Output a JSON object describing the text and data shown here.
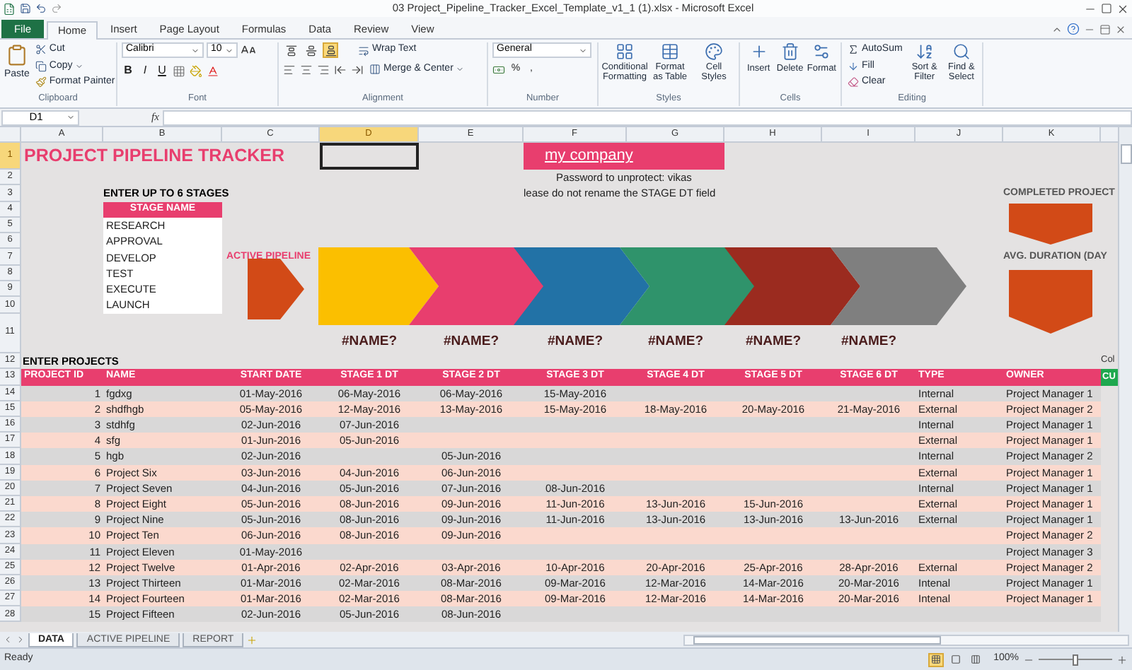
{
  "window": {
    "title": "03 Project_Pipeline_Tracker_Excel_Template_v1_1 (1).xlsx  -  Microsoft Excel"
  },
  "ribbon": {
    "file_tab": "File",
    "tabs": [
      {
        "label": "Home",
        "selected": true
      },
      {
        "label": "Insert",
        "selected": false
      },
      {
        "label": "Page Layout",
        "selected": false
      },
      {
        "label": "Formulas",
        "selected": false
      },
      {
        "label": "Data",
        "selected": false
      },
      {
        "label": "Review",
        "selected": false
      },
      {
        "label": "View",
        "selected": false
      }
    ],
    "clipboard": {
      "paste": "Paste",
      "cut": "Cut",
      "copy": "Copy",
      "format_painter": "Format Painter",
      "label": "Clipboard"
    },
    "font": {
      "name": "Calibri",
      "size": "10",
      "styles": [
        "B",
        "I",
        "U"
      ],
      "label": "Font"
    },
    "alignment": {
      "vertical_buttons": [
        {
          "selected": false
        },
        {
          "selected": false
        },
        {
          "selected": true
        }
      ],
      "wrap_text": "Wrap Text",
      "merge_center": "Merge & Center",
      "label": "Alignment"
    },
    "number": {
      "format": "General",
      "symbols": [
        "%",
        ","
      ],
      "label": "Number"
    },
    "styles": {
      "buttons": [
        "Conditional Formatting",
        "Format as Table",
        "Cell Styles"
      ],
      "label": "Styles"
    },
    "cells": {
      "buttons": [
        "Insert",
        "Delete",
        "Format"
      ],
      "label": "Cells"
    },
    "editing": {
      "autosum": "AutoSum",
      "fill": "Fill",
      "clear": "Clear",
      "buttons": [
        "Sort & Filter",
        "Find & Select"
      ],
      "label": "Editing"
    }
  },
  "formula_bar": {
    "name_box": "D1",
    "fx": "fx"
  },
  "columns": [
    {
      "label": "A",
      "selected": false
    },
    {
      "label": "B",
      "selected": false
    },
    {
      "label": "C",
      "selected": false
    },
    {
      "label": "D",
      "selected": true
    },
    {
      "label": "E",
      "selected": false
    },
    {
      "label": "F",
      "selected": false
    },
    {
      "label": "G",
      "selected": false
    },
    {
      "label": "H",
      "selected": false
    },
    {
      "label": "I",
      "selected": false
    },
    {
      "label": "J",
      "selected": false
    },
    {
      "label": "K",
      "selected": false
    }
  ],
  "row_numbers": [
    {
      "label": "1",
      "selected": true
    },
    {
      "label": "2",
      "selected": false
    },
    {
      "label": "3",
      "selected": false
    },
    {
      "label": "4",
      "selected": false
    },
    {
      "label": "5",
      "selected": false
    },
    {
      "label": "6",
      "selected": false
    },
    {
      "label": "7",
      "selected": false
    },
    {
      "label": "8",
      "selected": false
    },
    {
      "label": "9",
      "selected": false
    },
    {
      "label": "10",
      "selected": false
    },
    {
      "label": "11",
      "selected": false
    },
    {
      "label": "12",
      "selected": false
    },
    {
      "label": "13",
      "selected": false
    },
    {
      "label": "14",
      "selected": false
    },
    {
      "label": "15",
      "selected": false
    },
    {
      "label": "16",
      "selected": false
    },
    {
      "label": "17",
      "selected": false
    },
    {
      "label": "18",
      "selected": false
    },
    {
      "label": "19",
      "selected": false
    },
    {
      "label": "20",
      "selected": false
    },
    {
      "label": "21",
      "selected": false
    },
    {
      "label": "22",
      "selected": false
    },
    {
      "label": "23",
      "selected": false
    },
    {
      "label": "24",
      "selected": false
    },
    {
      "label": "25",
      "selected": false
    },
    {
      "label": "26",
      "selected": false
    },
    {
      "label": "27",
      "selected": false
    },
    {
      "label": "28",
      "selected": false
    }
  ],
  "sheet": {
    "title": "PROJECT PIPELINE TRACKER",
    "company_link": "my company",
    "password_note": "Password to unprotect: vikas",
    "rename_note": "lease do not rename the STAGE DT field",
    "stages_box": {
      "heading": "ENTER UP TO 6 STAGES",
      "header": "STAGE NAME",
      "items": [
        "RESEARCH",
        "APPROVAL",
        "DEVELOP",
        "TEST",
        "EXECUTE",
        "LAUNCH"
      ]
    },
    "pipeline": {
      "label": "ACTIVE PIPELINE",
      "stages": [
        {
          "label": "#NAME?",
          "color": "#fbbf00"
        },
        {
          "label": "#NAME?",
          "color": "#e83e6e"
        },
        {
          "label": "#NAME?",
          "color": "#2272a6"
        },
        {
          "label": "#NAME?",
          "color": "#2f936b"
        },
        {
          "label": "#NAME?",
          "color": "#9b2b1f"
        },
        {
          "label": "#NAME?",
          "color": "#7f7f7f"
        }
      ]
    },
    "completed_label": "COMPLETED PROJECT",
    "duration_label": "AVG. DURATION (DAY",
    "projects_heading": "ENTER PROJECTS",
    "column_l_note": "Col",
    "table": {
      "columns": [
        "PROJECT ID",
        "NAME",
        "START DATE",
        "STAGE 1 DT",
        "STAGE 2 DT",
        "STAGE 3 DT",
        "STAGE 4 DT",
        "STAGE 5 DT",
        "STAGE 6 DT",
        "TYPE",
        "OWNER"
      ],
      "column_l_heading": "CU",
      "rows": [
        {
          "id": "1",
          "name": "fgdxg",
          "start": "01-May-2016",
          "stages": {
            "1": "06-May-2016",
            "2": "06-May-2016",
            "3": "15-May-2016"
          },
          "type": "Internal",
          "owner": "Project Manager 1"
        },
        {
          "id": "2",
          "name": "shdfhgb",
          "start": "05-May-2016",
          "stages": {
            "1": "12-May-2016",
            "2": "13-May-2016",
            "3": "15-May-2016",
            "4": "18-May-2016",
            "5": "20-May-2016",
            "6": "21-May-2016"
          },
          "type": "External",
          "owner": "Project Manager 2"
        },
        {
          "id": "3",
          "name": "stdhfg",
          "start": "02-Jun-2016",
          "stages": {
            "1": "07-Jun-2016"
          },
          "type": "Internal",
          "owner": "Project Manager 1"
        },
        {
          "id": "4",
          "name": "sfg",
          "start": "01-Jun-2016",
          "stages": {
            "1": "05-Jun-2016"
          },
          "type": "External",
          "owner": "Project Manager 1"
        },
        {
          "id": "5",
          "name": "hgb",
          "start": "02-Jun-2016",
          "stages": {
            "2": "05-Jun-2016"
          },
          "type": "Internal",
          "owner": "Project Manager 2"
        },
        {
          "id": "6",
          "name": "Project Six",
          "start": "03-Jun-2016",
          "stages": {
            "1": "04-Jun-2016",
            "2": "06-Jun-2016"
          },
          "type": "External",
          "owner": "Project Manager 1"
        },
        {
          "id": "7",
          "name": "Project Seven",
          "start": "04-Jun-2016",
          "stages": {
            "1": "05-Jun-2016",
            "2": "07-Jun-2016",
            "3": "08-Jun-2016"
          },
          "type": "Internal",
          "owner": "Project Manager 1"
        },
        {
          "id": "8",
          "name": "Project Eight",
          "start": "05-Jun-2016",
          "stages": {
            "1": "08-Jun-2016",
            "2": "09-Jun-2016",
            "3": "11-Jun-2016",
            "4": "13-Jun-2016",
            "5": "15-Jun-2016"
          },
          "type": "External",
          "owner": "Project Manager 1"
        },
        {
          "id": "9",
          "name": "Project Nine",
          "start": "05-Jun-2016",
          "stages": {
            "1": "08-Jun-2016",
            "2": "09-Jun-2016",
            "3": "11-Jun-2016",
            "4": "13-Jun-2016",
            "5": "13-Jun-2016",
            "6": "13-Jun-2016"
          },
          "type": "External",
          "owner": "Project Manager 1"
        },
        {
          "id": "10",
          "name": "Project Ten",
          "start": "06-Jun-2016",
          "stages": {
            "1": "08-Jun-2016",
            "2": "09-Jun-2016"
          },
          "owner": "Project Manager 2"
        },
        {
          "id": "11",
          "name": "Project Eleven",
          "start": "01-May-2016",
          "owner": "Project Manager 3"
        },
        {
          "id": "12",
          "name": "Project Twelve",
          "start": "01-Apr-2016",
          "stages": {
            "1": "02-Apr-2016",
            "2": "03-Apr-2016",
            "3": "10-Apr-2016",
            "4": "20-Apr-2016",
            "5": "25-Apr-2016",
            "6": "28-Apr-2016"
          },
          "type": "External",
          "owner": "Project Manager 2"
        },
        {
          "id": "13",
          "name": "Project Thirteen",
          "start": "01-Mar-2016",
          "stages": {
            "1": "02-Mar-2016",
            "2": "08-Mar-2016",
            "3": "09-Mar-2016",
            "4": "12-Mar-2016",
            "5": "14-Mar-2016",
            "6": "20-Mar-2016"
          },
          "type": "Intenal",
          "owner": "Project Manager 1"
        },
        {
          "id": "14",
          "name": "Project Fourteen",
          "start": "01-Mar-2016",
          "stages": {
            "1": "02-Mar-2016",
            "2": "08-Mar-2016",
            "3": "09-Mar-2016",
            "4": "12-Mar-2016",
            "5": "14-Mar-2016",
            "6": "20-Mar-2016"
          },
          "type": "Intenal",
          "owner": "Project Manager 1"
        },
        {
          "id": "15",
          "name": "Project Fifteen",
          "start": "02-Jun-2016",
          "stages": {
            "1": "05-Jun-2016",
            "2": "08-Jun-2016"
          }
        }
      ]
    }
  },
  "sheet_tabs": [
    {
      "label": "DATA",
      "selected": true
    },
    {
      "label": "ACTIVE PIPELINE",
      "selected": false
    },
    {
      "label": "REPORT",
      "selected": false
    }
  ],
  "status_bar": {
    "text": "Ready",
    "views": [
      {
        "selected": true
      },
      {
        "selected": false
      },
      {
        "selected": false
      }
    ],
    "zoom": "100%",
    "zoom_slider": {
      "level": 0.5
    }
  }
}
